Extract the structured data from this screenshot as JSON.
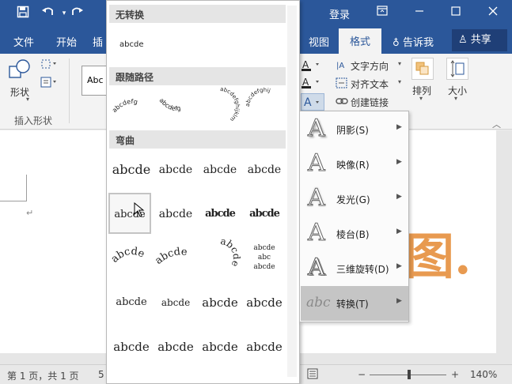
{
  "titlebar": {
    "login": "登录",
    "icons": [
      "save-icon",
      "undo-icon",
      "redo-icon",
      "ribbon-display-icon",
      "minimize-icon",
      "maximize-icon",
      "close-icon"
    ]
  },
  "tabs": {
    "file": "文件",
    "home": "开始",
    "insert_partial": "插",
    "view": "视图",
    "format": "格式",
    "tell_me": "告诉我",
    "share": "共享"
  },
  "ribbon": {
    "shape_label": "形状",
    "insert_shapes_group": "插入形状",
    "style_preview": "Abc",
    "text_direction": "文字方向",
    "align_text": "对齐文本",
    "create_link": "创建链接",
    "arrange": "排列",
    "size": "大小"
  },
  "gallery": {
    "sections": {
      "no_transform": "无转换",
      "follow_path": "跟随路径",
      "warp": "弯曲"
    },
    "plain_sample": "abcde",
    "path_sample": "abcdefg",
    "path_sample_long": "abcdefghijklm",
    "path_sample_button": "abcdefghij",
    "warp_sample": "abcde",
    "warp_stack": [
      "abcde",
      "abc",
      "abcde"
    ]
  },
  "effects_menu": {
    "items": [
      {
        "label": "阴影(S)",
        "icon": "shadow-a-icon"
      },
      {
        "label": "映像(R)",
        "icon": "reflection-a-icon"
      },
      {
        "label": "发光(G)",
        "icon": "glow-a-icon"
      },
      {
        "label": "棱台(B)",
        "icon": "bevel-a-icon"
      },
      {
        "label": "三维旋转(D)",
        "icon": "3d-rotation-a-icon"
      },
      {
        "label": "转换(T)",
        "icon": "transform-abc-icon"
      }
    ],
    "transform_icon_text": "abc",
    "effect_icon_letter": "A"
  },
  "statusbar": {
    "page_info": "第 1 页，共 1 页",
    "word_count_partial": "5",
    "zoom": "140%",
    "zoom_out": "−",
    "zoom_in": "+",
    "zoom_level": 0.52
  },
  "document": {
    "wordart_partial": "图."
  },
  "colors": {
    "brand_blue": "#2b579a",
    "wordart_orange": "#e89a50",
    "menu_active": "#c5c5c5"
  }
}
